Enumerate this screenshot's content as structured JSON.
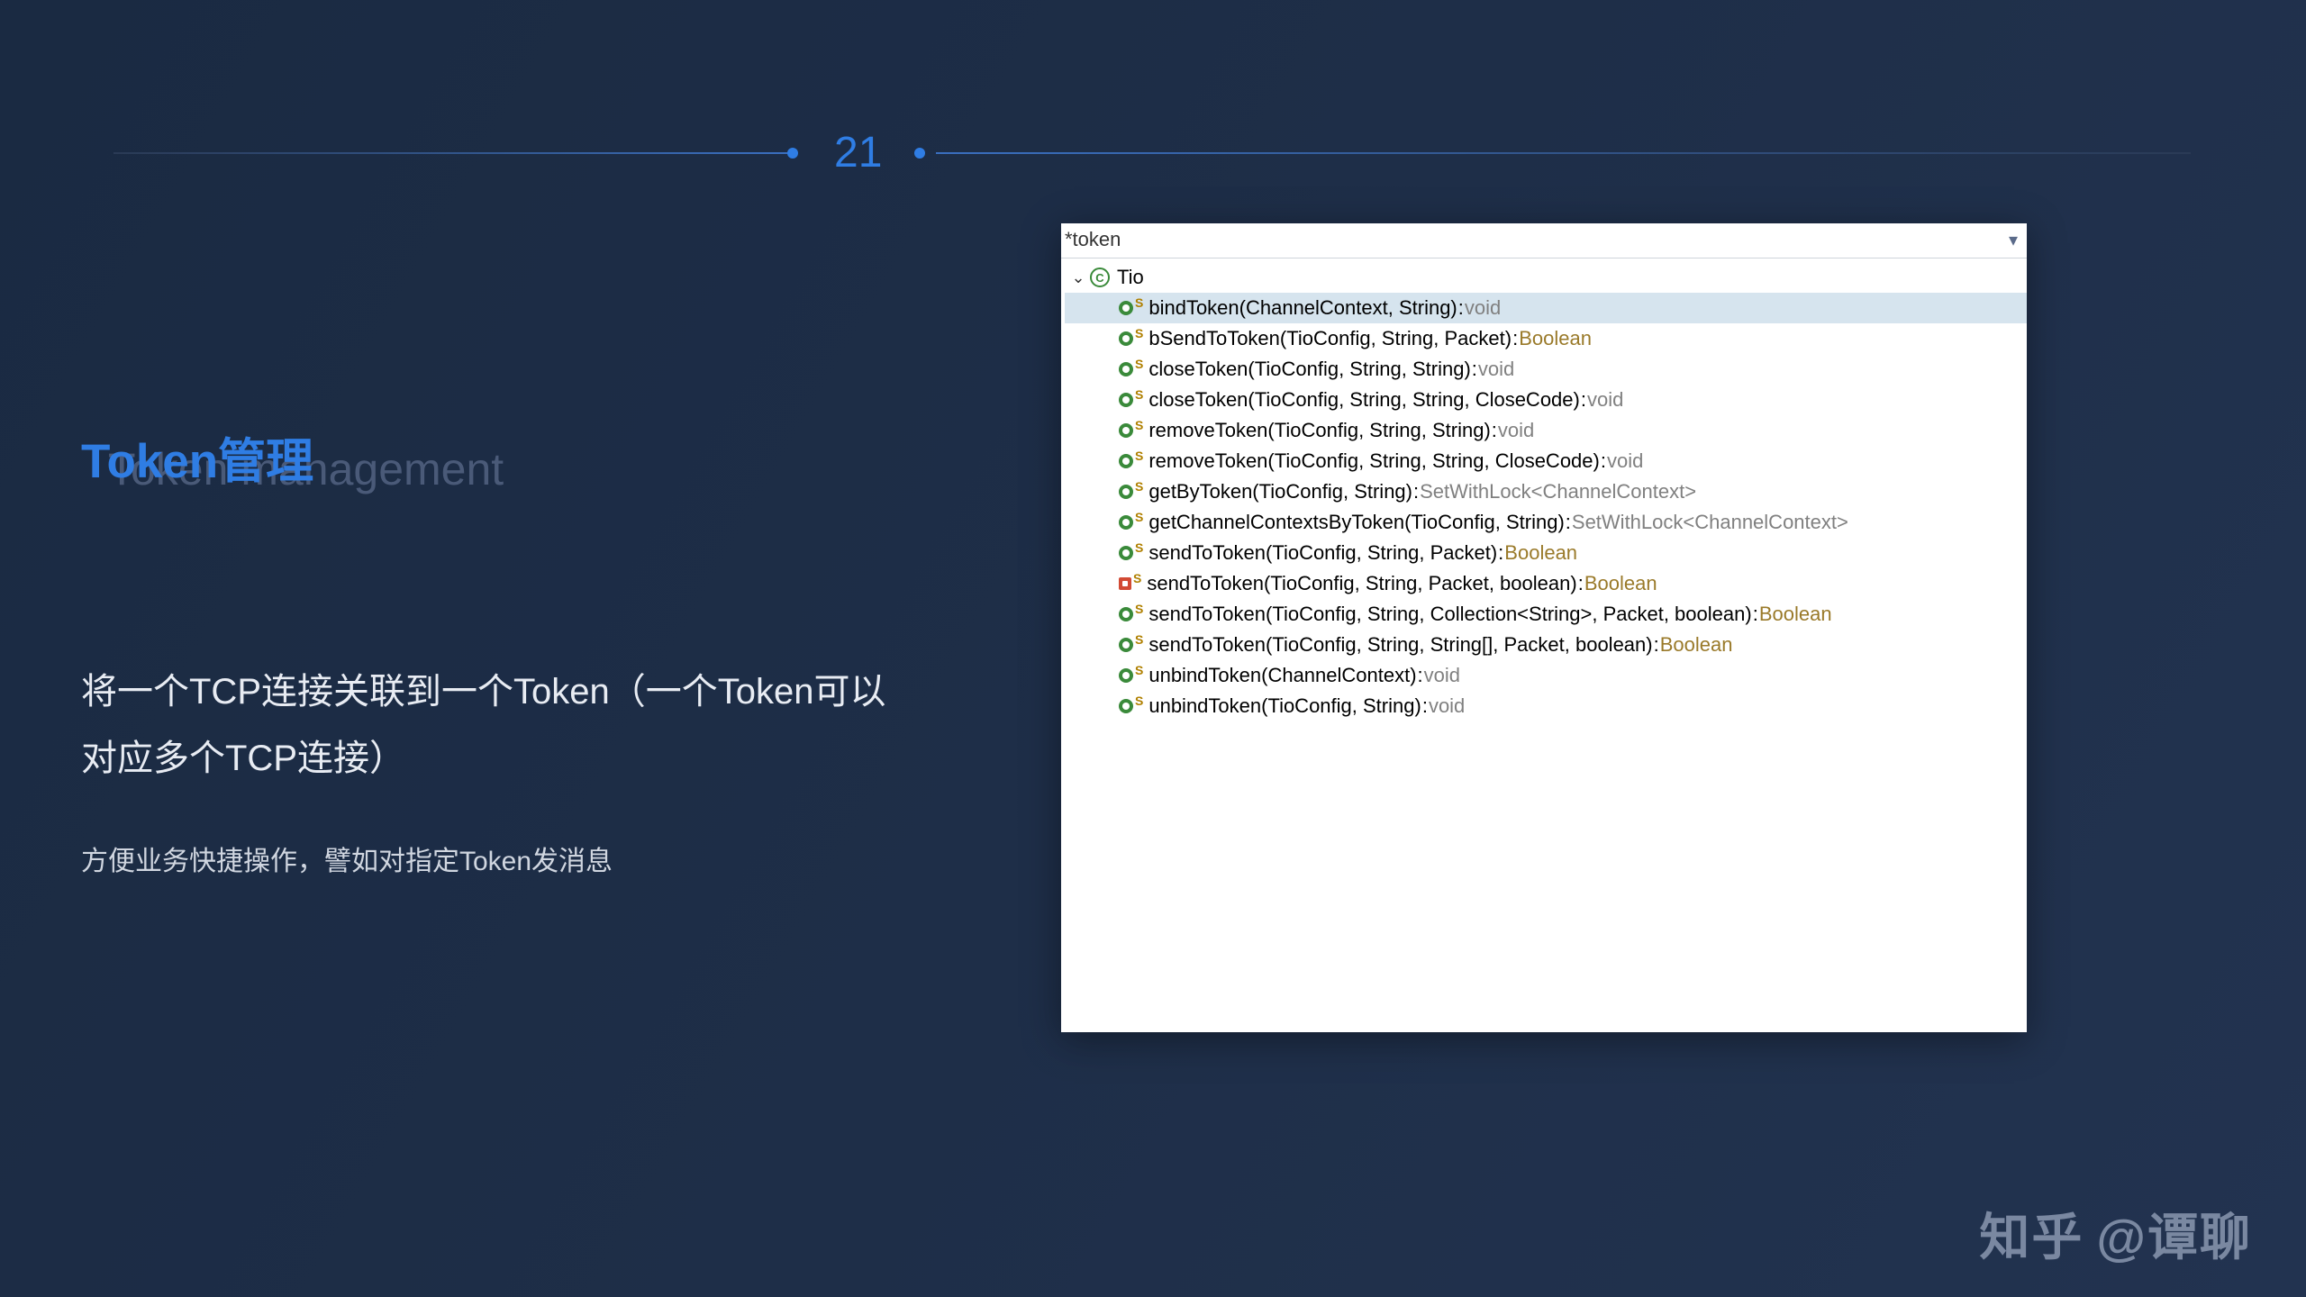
{
  "page_number": "21",
  "title": "Token管理",
  "title_shadow": "Token management",
  "desc_big": "将一个TCP连接关联到一个Token（一个Token可以对应多个TCP连接）",
  "desc_small": "方便业务快捷操作，譬如对指定Token发消息",
  "ide": {
    "search": "*token",
    "class_name": "Tio",
    "methods": [
      {
        "icon": "pub",
        "sig": "bindToken(ChannelContext, String)",
        "ret": "void",
        "ret_style": "void",
        "selected": true
      },
      {
        "icon": "pub",
        "sig": "bSendToToken(TioConfig, String, Packet)",
        "ret": "Boolean",
        "ret_style": "obj"
      },
      {
        "icon": "pub",
        "sig": "closeToken(TioConfig, String, String)",
        "ret": "void",
        "ret_style": "void"
      },
      {
        "icon": "pub",
        "sig": "closeToken(TioConfig, String, String, CloseCode)",
        "ret": "void",
        "ret_style": "void"
      },
      {
        "icon": "pub",
        "sig": "removeToken(TioConfig, String, String)",
        "ret": "void",
        "ret_style": "void"
      },
      {
        "icon": "pub",
        "sig": "removeToken(TioConfig, String, String, CloseCode)",
        "ret": "void",
        "ret_style": "void"
      },
      {
        "icon": "pub",
        "sig": "getByToken(TioConfig, String)",
        "ret": "SetWithLock<ChannelContext>",
        "ret_style": "generic"
      },
      {
        "icon": "def",
        "sig": "getChannelContextsByToken(TioConfig, String)",
        "ret": "SetWithLock<ChannelContext>",
        "ret_style": "generic"
      },
      {
        "icon": "pub",
        "sig": "sendToToken(TioConfig, String, Packet)",
        "ret": "Boolean",
        "ret_style": "obj"
      },
      {
        "icon": "priv",
        "sig": "sendToToken(TioConfig, String, Packet, boolean)",
        "ret": "Boolean",
        "ret_style": "obj"
      },
      {
        "icon": "pub",
        "sig": "sendToToken(TioConfig, String, Collection<String>, Packet, boolean)",
        "ret": "Boolean",
        "ret_style": "obj"
      },
      {
        "icon": "pub",
        "sig": "sendToToken(TioConfig, String, String[], Packet, boolean)",
        "ret": "Boolean",
        "ret_style": "obj"
      },
      {
        "icon": "pub",
        "sig": "unbindToken(ChannelContext)",
        "ret": "void",
        "ret_style": "void"
      },
      {
        "icon": "pub",
        "sig": "unbindToken(TioConfig, String)",
        "ret": "void",
        "ret_style": "void"
      }
    ]
  },
  "watermark": {
    "site": "知乎",
    "author": "@谭聊"
  }
}
